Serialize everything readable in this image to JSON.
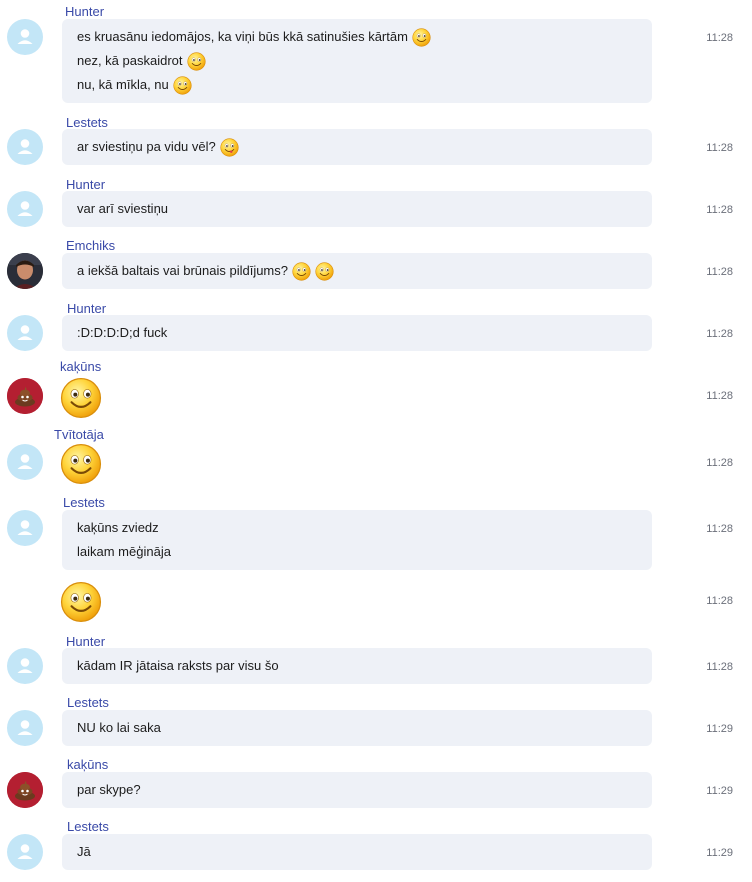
{
  "messages": [
    {
      "sender": "Hunter",
      "avatar": "default",
      "time": "11:28",
      "lines": [
        {
          "text": "es kruasānu iedomājos, ka viņi būs kkā satinušies kārtām",
          "emojis": [
            "smile"
          ]
        },
        {
          "text": "nez, kā paskaidrot",
          "emojis": [
            "smile"
          ]
        },
        {
          "text": "nu, kā mīkla, nu",
          "emojis": [
            "smile"
          ]
        }
      ]
    },
    {
      "sender": "Lestets",
      "avatar": "default",
      "time": "11:28",
      "lines": [
        {
          "text": "ar sviestiņu pa vidu vēl?",
          "emojis": [
            "tongue"
          ]
        }
      ]
    },
    {
      "sender": "Hunter",
      "avatar": "default",
      "time": "11:28",
      "lines": [
        {
          "text": "var arī sviestiņu",
          "emojis": []
        }
      ]
    },
    {
      "sender": "Emchiks",
      "avatar": "photo",
      "time": "11:28",
      "lines": [
        {
          "text": "a iekšā baltais vai brūnais pildījums?",
          "emojis": [
            "smile",
            "smile"
          ]
        }
      ]
    },
    {
      "sender": "Hunter",
      "avatar": "default",
      "time": "11:28",
      "lines": [
        {
          "text": ":D:D:D:D;d fuck",
          "emojis": []
        }
      ]
    },
    {
      "sender": "kaķūns",
      "avatar": "poop",
      "time": "11:28",
      "big_emoji": "smile"
    },
    {
      "sender": "Tvītotāja",
      "avatar": "default",
      "time": "11:28",
      "big_emoji": "smile"
    },
    {
      "sender": "Lestets",
      "avatar": "default",
      "time": "11:28",
      "lines": [
        {
          "text": "kaķūns zviedz",
          "emojis": []
        },
        {
          "text": "laikam mēģināja",
          "emojis": []
        }
      ]
    },
    {
      "sender": "",
      "avatar": "none",
      "time": "11:28",
      "big_emoji": "smile"
    },
    {
      "sender": "Hunter",
      "avatar": "default",
      "time": "11:28",
      "lines": [
        {
          "text": "kādam IR jātaisa raksts par visu šo",
          "emojis": []
        }
      ]
    },
    {
      "sender": "Lestets",
      "avatar": "default",
      "time": "11:29",
      "lines": [
        {
          "text": "NU ko lai saka",
          "emojis": []
        }
      ]
    },
    {
      "sender": "kaķūns",
      "avatar": "poop",
      "time": "11:29",
      "lines": [
        {
          "text": "par skype?",
          "emojis": []
        }
      ]
    },
    {
      "sender": "Lestets",
      "avatar": "default",
      "time": "11:29",
      "lines": [
        {
          "text": "Jā",
          "emojis": []
        }
      ]
    }
  ],
  "colors": {
    "sender_name": "#3a4aa8",
    "bubble": "#eef1f7",
    "default_avatar": "#c3e6f7",
    "timestamp": "#6b6f7a"
  }
}
